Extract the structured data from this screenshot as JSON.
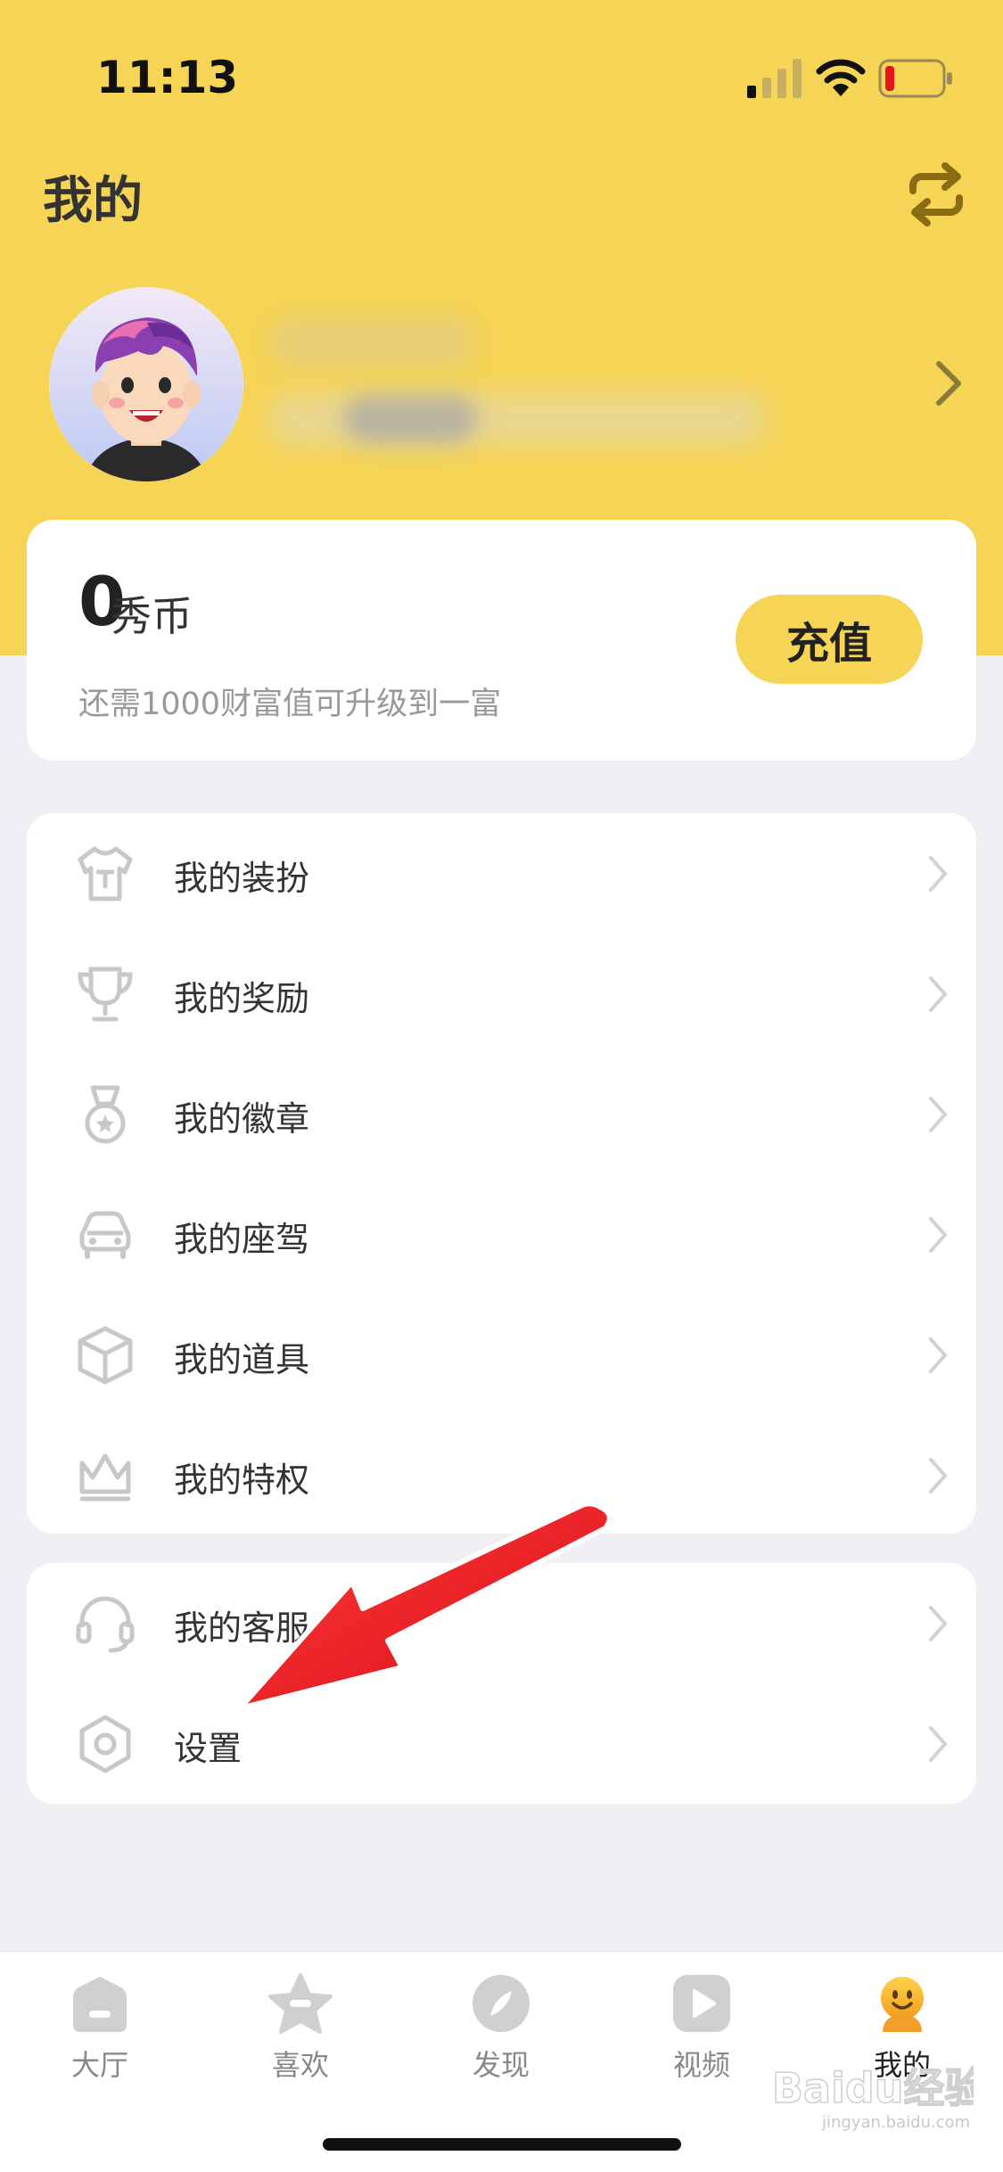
{
  "status_bar": {
    "time": "11:13"
  },
  "header": {
    "title": "我的"
  },
  "wallet": {
    "coin_amount": "0",
    "coin_unit": "秀币",
    "wealth_hint": "还需1000财富值可升级到一富",
    "recharge_label": "充值"
  },
  "menu_main": [
    {
      "label": "我的装扮",
      "icon": "tshirt-icon"
    },
    {
      "label": "我的奖励",
      "icon": "trophy-icon"
    },
    {
      "label": "我的徽章",
      "icon": "medal-icon"
    },
    {
      "label": "我的座驾",
      "icon": "car-icon"
    },
    {
      "label": "我的道具",
      "icon": "box-icon"
    },
    {
      "label": "我的特权",
      "icon": "crown-icon"
    }
  ],
  "menu_secondary": [
    {
      "label": "我的客服",
      "icon": "headset-icon"
    },
    {
      "label": "设置",
      "icon": "hexagon-settings-icon"
    }
  ],
  "tabbar": [
    {
      "label": "大厅",
      "icon": "lobby-icon",
      "active": false
    },
    {
      "label": "喜欢",
      "icon": "star-icon",
      "active": false
    },
    {
      "label": "发现",
      "icon": "compass-icon",
      "active": false
    },
    {
      "label": "视频",
      "icon": "play-icon",
      "active": false
    },
    {
      "label": "我的",
      "icon": "mascot-icon",
      "active": true
    }
  ],
  "watermark": {
    "brand": "Baidu经验",
    "url": "jingyan.baidu.com"
  },
  "colors": {
    "brand_yellow": "#f6d455",
    "annotation_arrow": "#e8141c",
    "background": "#efeff4"
  }
}
